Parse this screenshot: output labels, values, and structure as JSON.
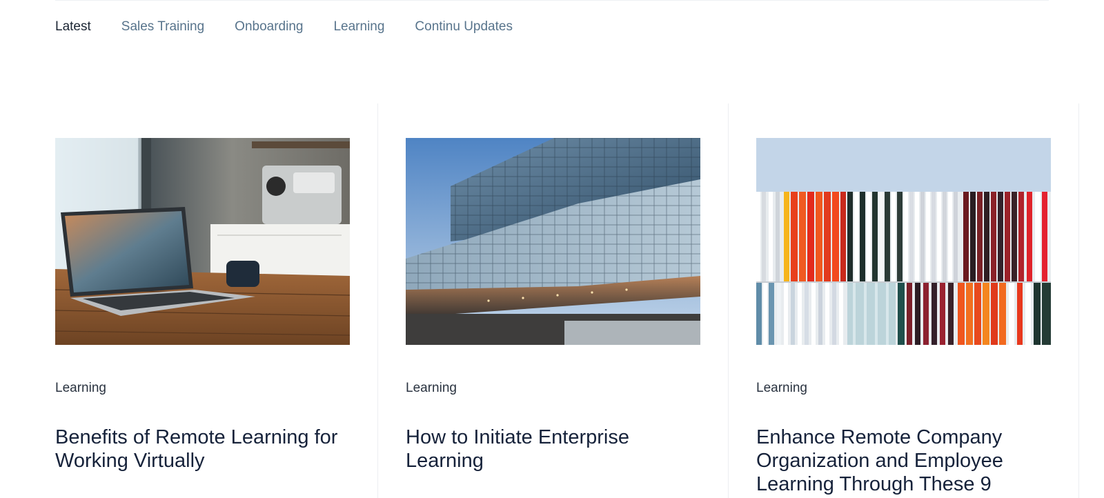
{
  "tabs": [
    {
      "label": "Latest",
      "active": true
    },
    {
      "label": "Sales Training",
      "active": false
    },
    {
      "label": "Onboarding",
      "active": false
    },
    {
      "label": "Learning",
      "active": false
    },
    {
      "label": "Continu Updates",
      "active": false
    }
  ],
  "cards": [
    {
      "image": "laptop-on-wooden-table-photo",
      "category": "Learning",
      "title": "Benefits of Remote Learning for Working Virtually"
    },
    {
      "image": "glass-office-building-photo",
      "category": "Learning",
      "title": "How to Initiate Enterprise Learning"
    },
    {
      "image": "colorful-striped-facade-photo",
      "category": "Learning",
      "title": "Enhance Remote Company Organization and Employee Learning Through These 9"
    }
  ],
  "colors": {
    "tab_active": "#1b2533",
    "tab_inactive": "#58748c",
    "title": "#16223a",
    "category": "#2a3340",
    "divider": "#eceef1"
  }
}
